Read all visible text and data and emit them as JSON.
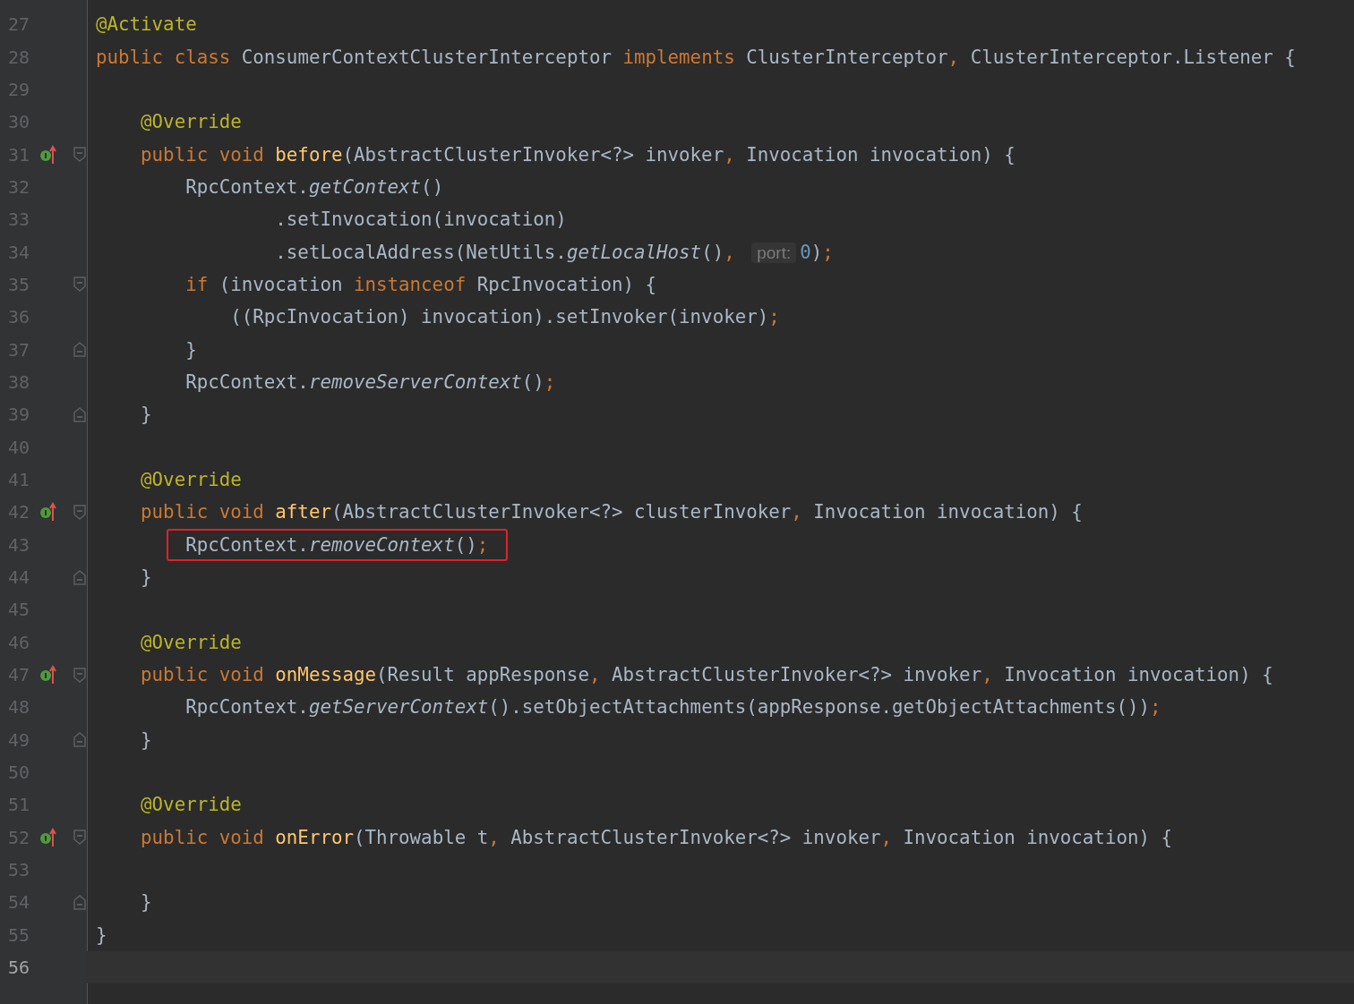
{
  "editor": {
    "lines": [
      {
        "number": "27",
        "current": false,
        "marker": false,
        "fold_open": false,
        "fold_close": false,
        "highlighted": false,
        "tokens": [
          {
            "kind": "annotation",
            "text": "@Activate"
          }
        ]
      },
      {
        "number": "28",
        "current": false,
        "marker": false,
        "fold_open": false,
        "fold_close": false,
        "highlighted": false,
        "tokens": [
          {
            "kind": "keyword",
            "text": "public class "
          },
          {
            "kind": "plain",
            "text": "ConsumerContextClusterInterceptor "
          },
          {
            "kind": "keyword",
            "text": "implements "
          },
          {
            "kind": "plain",
            "text": "ClusterInterceptor"
          },
          {
            "kind": "punct",
            "text": ", "
          },
          {
            "kind": "plain",
            "text": "ClusterInterceptor.Listener {"
          }
        ],
        "children": [
          {
            "number": "29",
            "current": false,
            "marker": false,
            "fold_open": false,
            "fold_close": false,
            "highlighted": false
          },
          {
            "number": "30",
            "current": false,
            "marker": false,
            "fold_open": false,
            "fold_close": false,
            "highlighted": false,
            "tokens": [
              {
                "kind": "annotation",
                "text": "@Override"
              }
            ]
          },
          {
            "number": "31",
            "current": false,
            "marker": true,
            "fold_open": true,
            "fold_close": false,
            "highlighted": false,
            "tokens": [
              {
                "kind": "keyword",
                "text": "public void "
              },
              {
                "kind": "function",
                "text": "before"
              },
              {
                "kind": "plain",
                "text": "(AbstractClusterInvoker<?> invoker"
              },
              {
                "kind": "punct",
                "text": ", "
              },
              {
                "kind": "plain",
                "text": "Invocation invocation) {"
              }
            ],
            "children": [
              {
                "number": "32",
                "current": false,
                "marker": false,
                "fold_open": false,
                "fold_close": false,
                "highlighted": false,
                "tokens": [
                  {
                    "kind": "plain",
                    "text": "RpcContext."
                  },
                  {
                    "kind": "static",
                    "text": "getContext"
                  },
                  {
                    "kind": "plain",
                    "text": "()"
                  }
                ],
                "children": [
                  {
                    "number": "33",
                    "current": false,
                    "continuation": true,
                    "marker": false,
                    "fold_open": false,
                    "fold_close": false,
                    "highlighted": false,
                    "tokens": [
                      {
                        "kind": "plain",
                        "text": ".setInvocation(invocation)"
                      }
                    ]
                  },
                  {
                    "number": "34",
                    "current": false,
                    "continuation": true,
                    "marker": false,
                    "fold_open": false,
                    "fold_close": false,
                    "highlighted": false,
                    "tokens": [
                      {
                        "kind": "plain",
                        "text": ".setLocalAddress(NetUtils."
                      },
                      {
                        "kind": "static",
                        "text": "getLocalHost"
                      },
                      {
                        "kind": "plain",
                        "text": "()"
                      },
                      {
                        "kind": "punct",
                        "text": ", "
                      },
                      {
                        "kind": "hint",
                        "text": "port:"
                      },
                      {
                        "kind": "number",
                        "text": "0"
                      },
                      {
                        "kind": "plain",
                        "text": ")"
                      },
                      {
                        "kind": "punct",
                        "text": ";"
                      }
                    ]
                  }
                ]
              },
              {
                "number": "35",
                "current": false,
                "marker": false,
                "fold_open": true,
                "fold_close": false,
                "highlighted": false,
                "tokens": [
                  {
                    "kind": "keyword",
                    "text": "if "
                  },
                  {
                    "kind": "plain",
                    "text": "(invocation "
                  },
                  {
                    "kind": "keyword",
                    "text": "instanceof "
                  },
                  {
                    "kind": "plain",
                    "text": "RpcInvocation) {"
                  }
                ],
                "children": [
                  {
                    "number": "36",
                    "current": false,
                    "marker": false,
                    "fold_open": false,
                    "fold_close": false,
                    "highlighted": false,
                    "tokens": [
                      {
                        "kind": "plain",
                        "text": "((RpcInvocation) invocation).setInvoker(invoker)"
                      },
                      {
                        "kind": "punct",
                        "text": ";"
                      }
                    ]
                  }
                ]
              },
              {
                "number": "37",
                "current": false,
                "marker": false,
                "fold_open": false,
                "fold_close": true,
                "highlighted": false,
                "tokens": [
                  {
                    "kind": "plain",
                    "text": "}"
                  }
                ]
              },
              {
                "number": "38",
                "current": false,
                "marker": false,
                "fold_open": false,
                "fold_close": false,
                "highlighted": false,
                "tokens": [
                  {
                    "kind": "plain",
                    "text": "RpcContext."
                  },
                  {
                    "kind": "static",
                    "text": "removeServerContext"
                  },
                  {
                    "kind": "plain",
                    "text": "()"
                  },
                  {
                    "kind": "punct",
                    "text": ";"
                  }
                ]
              }
            ]
          },
          {
            "number": "39",
            "current": false,
            "marker": false,
            "fold_open": false,
            "fold_close": true,
            "highlighted": false,
            "tokens": [
              {
                "kind": "plain",
                "text": "}"
              }
            ]
          },
          {
            "number": "40",
            "current": false,
            "marker": false,
            "fold_open": false,
            "fold_close": false,
            "highlighted": false
          },
          {
            "number": "41",
            "current": false,
            "marker": false,
            "fold_open": false,
            "fold_close": false,
            "highlighted": false,
            "tokens": [
              {
                "kind": "annotation",
                "text": "@Override"
              }
            ]
          },
          {
            "number": "42",
            "current": false,
            "marker": true,
            "fold_open": true,
            "fold_close": false,
            "highlighted": false,
            "tokens": [
              {
                "kind": "keyword",
                "text": "public void "
              },
              {
                "kind": "function",
                "text": "after"
              },
              {
                "kind": "plain",
                "text": "(AbstractClusterInvoker<?> clusterInvoker"
              },
              {
                "kind": "punct",
                "text": ", "
              },
              {
                "kind": "plain",
                "text": "Invocation invocation) {"
              }
            ],
            "children": [
              {
                "number": "43",
                "current": false,
                "marker": false,
                "fold_open": false,
                "fold_close": false,
                "highlighted": true,
                "tokens": [
                  {
                    "kind": "plain",
                    "text": "RpcContext."
                  },
                  {
                    "kind": "static",
                    "text": "removeContext"
                  },
                  {
                    "kind": "plain",
                    "text": "()"
                  },
                  {
                    "kind": "punct",
                    "text": ";"
                  }
                ]
              }
            ]
          },
          {
            "number": "44",
            "current": false,
            "marker": false,
            "fold_open": false,
            "fold_close": true,
            "highlighted": false,
            "tokens": [
              {
                "kind": "plain",
                "text": "}"
              }
            ]
          },
          {
            "number": "45",
            "current": false,
            "marker": false,
            "fold_open": false,
            "fold_close": false,
            "highlighted": false
          },
          {
            "number": "46",
            "current": false,
            "marker": false,
            "fold_open": false,
            "fold_close": false,
            "highlighted": false,
            "tokens": [
              {
                "kind": "annotation",
                "text": "@Override"
              }
            ]
          },
          {
            "number": "47",
            "current": false,
            "marker": true,
            "fold_open": true,
            "fold_close": false,
            "highlighted": false,
            "tokens": [
              {
                "kind": "keyword",
                "text": "public void "
              },
              {
                "kind": "function",
                "text": "onMessage"
              },
              {
                "kind": "plain",
                "text": "(Result appResponse"
              },
              {
                "kind": "punct",
                "text": ", "
              },
              {
                "kind": "plain",
                "text": "AbstractClusterInvoker<?> invoker"
              },
              {
                "kind": "punct",
                "text": ", "
              },
              {
                "kind": "plain",
                "text": "Invocation invocation) {"
              }
            ],
            "children": [
              {
                "number": "48",
                "current": false,
                "marker": false,
                "fold_open": false,
                "fold_close": false,
                "highlighted": false,
                "tokens": [
                  {
                    "kind": "plain",
                    "text": "RpcContext."
                  },
                  {
                    "kind": "static",
                    "text": "getServerContext"
                  },
                  {
                    "kind": "plain",
                    "text": "().setObjectAttachments(appResponse.getObjectAttachments())"
                  },
                  {
                    "kind": "punct",
                    "text": ";"
                  }
                ]
              }
            ]
          },
          {
            "number": "49",
            "current": false,
            "marker": false,
            "fold_open": false,
            "fold_close": true,
            "highlighted": false,
            "tokens": [
              {
                "kind": "plain",
                "text": "}"
              }
            ]
          },
          {
            "number": "50",
            "current": false,
            "marker": false,
            "fold_open": false,
            "fold_close": false,
            "highlighted": false
          },
          {
            "number": "51",
            "current": false,
            "marker": false,
            "fold_open": false,
            "fold_close": false,
            "highlighted": false,
            "tokens": [
              {
                "kind": "annotation",
                "text": "@Override"
              }
            ]
          },
          {
            "number": "52",
            "current": false,
            "marker": true,
            "fold_open": true,
            "fold_close": false,
            "highlighted": false,
            "tokens": [
              {
                "kind": "keyword",
                "text": "public void "
              },
              {
                "kind": "function",
                "text": "onError"
              },
              {
                "kind": "plain",
                "text": "(Throwable t"
              },
              {
                "kind": "punct",
                "text": ", "
              },
              {
                "kind": "plain",
                "text": "AbstractClusterInvoker<?> invoker"
              },
              {
                "kind": "punct",
                "text": ", "
              },
              {
                "kind": "plain",
                "text": "Invocation invocation) {"
              }
            ],
            "children": [
              {
                "number": "53",
                "current": false,
                "marker": false,
                "fold_open": false,
                "fold_close": false,
                "highlighted": false
              }
            ]
          },
          {
            "number": "54",
            "current": false,
            "marker": false,
            "fold_open": false,
            "fold_close": true,
            "highlighted": false,
            "tokens": [
              {
                "kind": "plain",
                "text": "}"
              }
            ]
          }
        ]
      },
      {
        "number": "55",
        "current": false,
        "marker": false,
        "fold_open": false,
        "fold_close": false,
        "highlighted": false,
        "tokens": [
          {
            "kind": "plain",
            "text": "}"
          }
        ]
      },
      {
        "number": "56",
        "current": true,
        "marker": false,
        "fold_open": false,
        "fold_close": false,
        "highlighted": false
      }
    ]
  }
}
